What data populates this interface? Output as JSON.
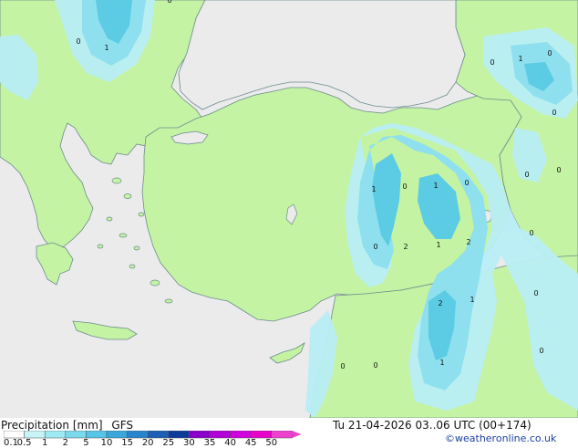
{
  "title": "Precipitation [mm]",
  "model": "GFS",
  "valid_time": "Tu 21-04-2026 03..06 UTC (00+174)",
  "credit": "©weatheronline.co.uk",
  "legend": {
    "labels": [
      "0.1",
      "0.5",
      "1",
      "2",
      "5",
      "10",
      "15",
      "20",
      "25",
      "30",
      "35",
      "40",
      "45",
      "50"
    ],
    "colors": [
      "#ffffff",
      "#c8f4f8",
      "#9eeaf2",
      "#7ad9ec",
      "#56c4e6",
      "#3aa6dc",
      "#2a84cc",
      "#1d5fb5",
      "#0f3b98",
      "#8a00c8",
      "#b000d6",
      "#d200dc",
      "#e800c8",
      "#f040d0"
    ]
  },
  "palette": {
    "land": "#c4f3a4",
    "sea": "#ebebeb",
    "light_precip": "#b9eef6",
    "medium_precip": "#8ee0ee",
    "heavy_precip": "#5ccbe4",
    "coastline": "#6d8a8d"
  },
  "map_values": [
    {
      "id": "v1",
      "text": "1"
    },
    {
      "id": "v2",
      "text": "0"
    },
    {
      "id": "v3",
      "text": "1"
    },
    {
      "id": "v4",
      "text": "0"
    },
    {
      "id": "v5",
      "text": "0"
    },
    {
      "id": "v6",
      "text": "0"
    },
    {
      "id": "v7",
      "text": "0"
    },
    {
      "id": "v8",
      "text": "0"
    },
    {
      "id": "v9",
      "text": "1"
    },
    {
      "id": "v10",
      "text": "0"
    },
    {
      "id": "v11",
      "text": "1"
    },
    {
      "id": "v12",
      "text": "0"
    },
    {
      "id": "v13",
      "text": "0"
    },
    {
      "id": "v14",
      "text": "2"
    },
    {
      "id": "v15",
      "text": "1"
    },
    {
      "id": "v16",
      "text": "2"
    },
    {
      "id": "v17",
      "text": "0"
    },
    {
      "id": "v18",
      "text": "2"
    },
    {
      "id": "v19",
      "text": "1"
    },
    {
      "id": "v20",
      "text": "0"
    },
    {
      "id": "v21",
      "text": "0"
    },
    {
      "id": "v22",
      "text": "1"
    },
    {
      "id": "v23",
      "text": "0"
    },
    {
      "id": "v24",
      "text": "0"
    },
    {
      "id": "v25",
      "text": "0"
    }
  ]
}
